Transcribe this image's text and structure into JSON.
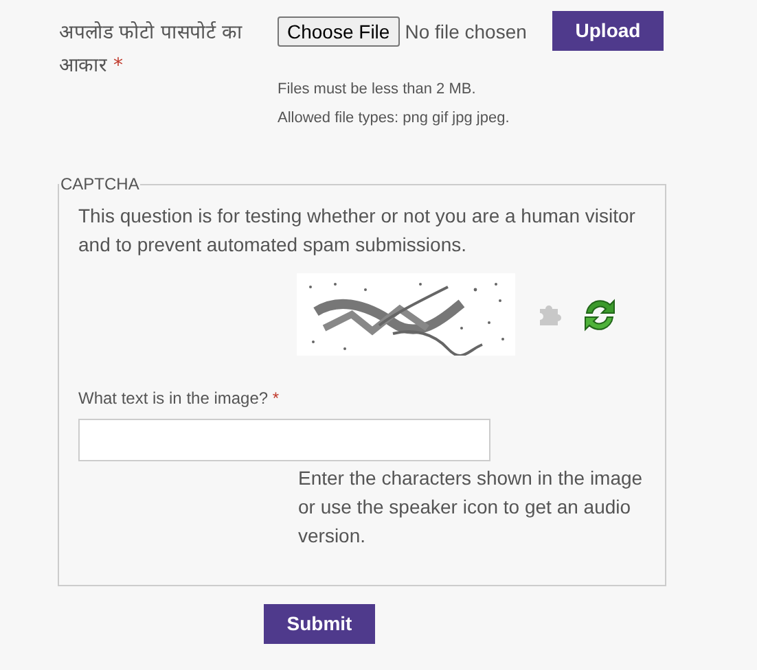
{
  "upload": {
    "label": "अपलोड फोटो पासपोर्ट का आकार",
    "required_mark": "*",
    "choose_button": "Choose File",
    "file_status": "No file chosen",
    "upload_button": "Upload",
    "help": [
      "Files must be less than 2 MB.",
      "Allowed file types: png gif jpg jpeg."
    ]
  },
  "captcha": {
    "legend": "CAPTCHA",
    "description": "This question is for testing whether or not you are a human visitor and to prevent automated spam submissions.",
    "field_label": "What text is in the image?",
    "required_mark": "*",
    "help": "Enter the characters shown in the image or use the speaker icon to get an audio version."
  },
  "submit_button": "Submit"
}
